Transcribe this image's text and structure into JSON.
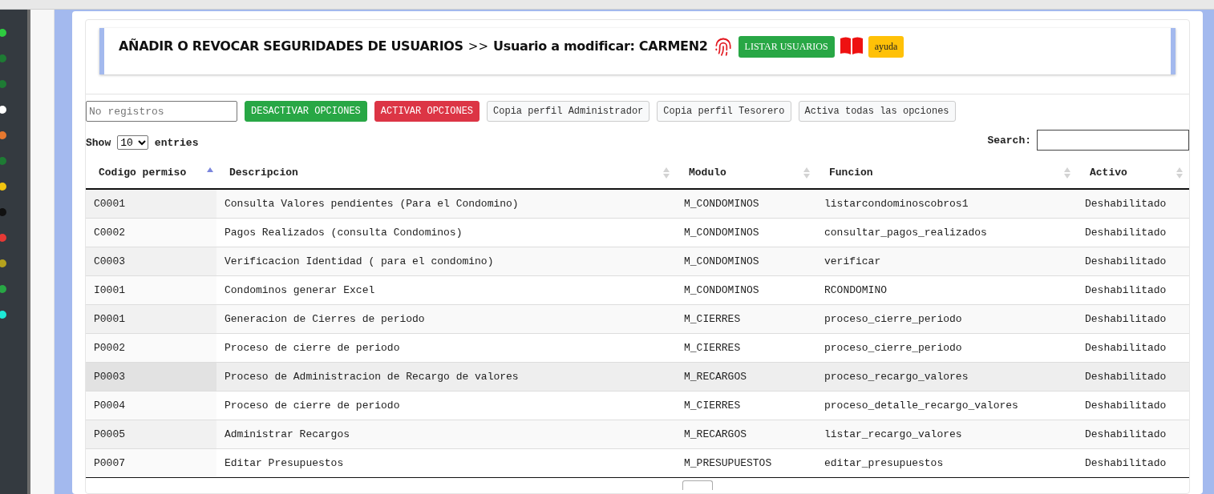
{
  "header": {
    "title": "AÑADIR O REVOCAR SEGURIDADES DE USUARIOS",
    "separator": ">>",
    "user_label": "Usuario a modificar: CARMEN2",
    "list_button": "LISTAR USUARIOS",
    "help_button": "ayuda"
  },
  "toolbar": {
    "records_field": {
      "placeholder": "No registros"
    },
    "buttons": [
      {
        "label": "DESACTIVAR OPCIONES",
        "kind": "success"
      },
      {
        "label": "ACTIVAR OPCIONES",
        "kind": "danger"
      },
      {
        "label": "Copia perfil Administrador",
        "kind": "light"
      },
      {
        "label": "Copia perfil Tesorero",
        "kind": "light"
      },
      {
        "label": "Activa todas las opciones",
        "kind": "light"
      }
    ]
  },
  "length": {
    "show": "Show",
    "value": "10",
    "entries": "entries"
  },
  "search": {
    "label": "Search:"
  },
  "table": {
    "columns": [
      {
        "label": "Codigo permiso",
        "sorted": true
      },
      {
        "label": "Descripcion",
        "sorted": false
      },
      {
        "label": "Modulo",
        "sorted": false
      },
      {
        "label": "Funcion",
        "sorted": false
      },
      {
        "label": "Activo",
        "sorted": false
      }
    ],
    "rows": [
      {
        "cells": [
          "C0001",
          "Consulta Valores pendientes (Para el Condomino)",
          "M_CONDOMINOS",
          "listarcondominoscobros1",
          "Deshabilitado"
        ],
        "highlighted": false
      },
      {
        "cells": [
          "C0002",
          "Pagos Realizados (consulta Condominos)",
          "M_CONDOMINOS",
          "consultar_pagos_realizados",
          "Deshabilitado"
        ],
        "highlighted": false
      },
      {
        "cells": [
          "C0003",
          "Verificacion Identidad ( para el condomino)",
          "M_CONDOMINOS",
          "verificar",
          "Deshabilitado"
        ],
        "highlighted": false
      },
      {
        "cells": [
          "I0001",
          "Condominos generar Excel",
          "M_CONDOMINOS",
          "RCONDOMINO",
          "Deshabilitado"
        ],
        "highlighted": false
      },
      {
        "cells": [
          "P0001",
          "Generacion de Cierres de periodo",
          "M_CIERRES",
          "proceso_cierre_periodo",
          "Deshabilitado"
        ],
        "highlighted": false
      },
      {
        "cells": [
          "P0002",
          "Proceso de cierre de periodo",
          "M_CIERRES",
          "proceso_cierre_periodo",
          "Deshabilitado"
        ],
        "highlighted": false
      },
      {
        "cells": [
          "P0003",
          "Proceso de Administracion de Recargo de valores",
          "M_RECARGOS",
          "proceso_recargo_valores",
          "Deshabilitado"
        ],
        "highlighted": true
      },
      {
        "cells": [
          "P0004",
          "Proceso de cierre de periodo",
          "M_CIERRES",
          "proceso_detalle_recargo_valores",
          "Deshabilitado"
        ],
        "highlighted": false
      },
      {
        "cells": [
          "P0005",
          "Administrar Recargos",
          "M_RECARGOS",
          "listar_recargo_valores",
          "Deshabilitado"
        ],
        "highlighted": false
      },
      {
        "cells": [
          "P0007",
          "Editar Presupuestos",
          "M_PRESUPUESTOS",
          "editar_presupuestos",
          "Deshabilitado"
        ],
        "highlighted": false
      }
    ]
  }
}
